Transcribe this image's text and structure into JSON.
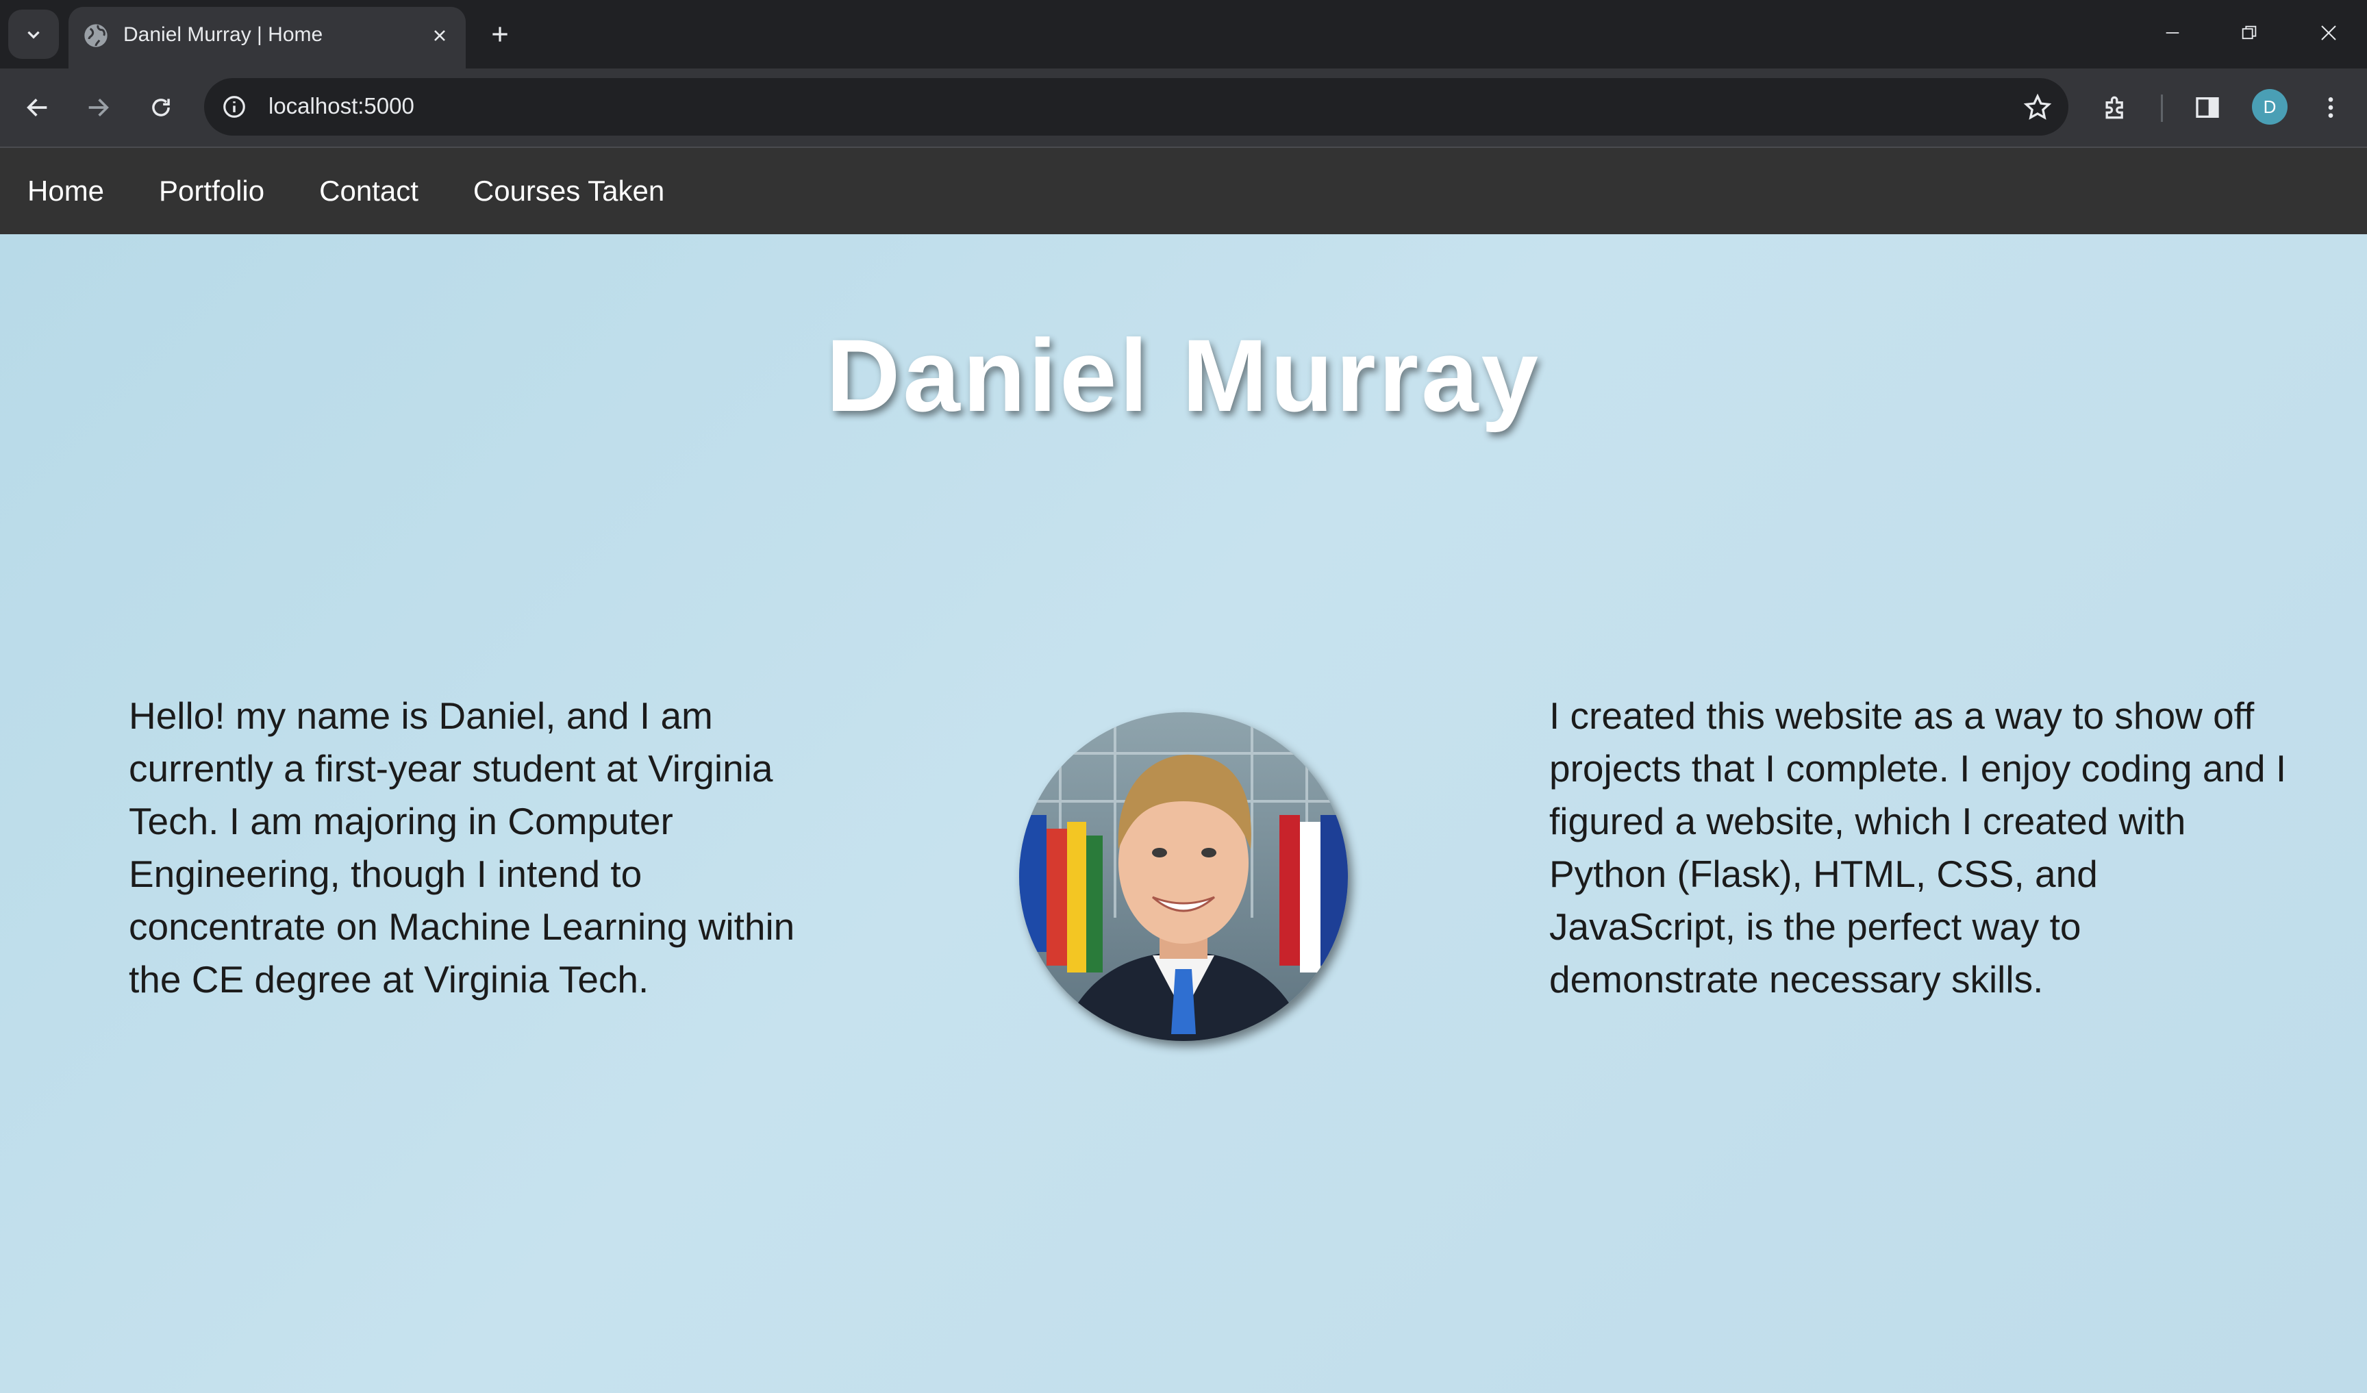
{
  "browser": {
    "tab_title": "Daniel Murray | Home",
    "url": "localhost:5000",
    "profile_initial": "D"
  },
  "nav": {
    "items": [
      "Home",
      "Portfolio",
      "Contact",
      "Courses Taken"
    ]
  },
  "hero": {
    "title": "Daniel Murray",
    "intro": "Hello! my name is Daniel, and I am currently a first-year student at Virginia Tech. I am majoring in Computer Engineering, though I intend to concentrate on Machine Learning within the CE degree at Virginia Tech.",
    "about": "I created this website as a way to show off projects that I complete. I enjoy coding and I figured a website, which I created with Python (Flask), HTML, CSS, and JavaScript, is the perfect way to demonstrate necessary skills."
  },
  "colors": {
    "nav_bg": "#333333",
    "hero_bg": "#c2deeb",
    "avatar": "#4a9fb5"
  }
}
